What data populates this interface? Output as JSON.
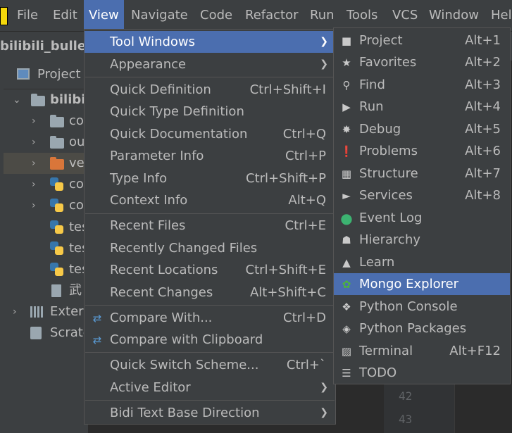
{
  "menubar": {
    "items": [
      "File",
      "Edit",
      "View",
      "Navigate",
      "Code",
      "Refactor",
      "Run",
      "Tools",
      "VCS",
      "Window",
      "Help"
    ],
    "active": "View"
  },
  "project_title": "bilibili_bullet_s",
  "project_panel": {
    "header": "Project",
    "tree": [
      {
        "label": "bilibili",
        "kind": "root-folder"
      },
      {
        "label": "co",
        "kind": "folder"
      },
      {
        "label": "ou",
        "kind": "folder"
      },
      {
        "label": "ve",
        "kind": "excluded-folder"
      },
      {
        "label": "co",
        "kind": "python-file"
      },
      {
        "label": "co",
        "kind": "python-file"
      },
      {
        "label": "tes",
        "kind": "python-file"
      },
      {
        "label": "tes",
        "kind": "python-file"
      },
      {
        "label": "tes",
        "kind": "python-file"
      },
      {
        "label": "武",
        "kind": "text-file"
      },
      {
        "label": "Extern",
        "kind": "libraries"
      },
      {
        "label": "Scrato",
        "kind": "scratches"
      }
    ]
  },
  "editor": {
    "line_numbers": [
      "42",
      "43"
    ]
  },
  "view_menu": {
    "items": [
      {
        "label": "Tool Windows",
        "shortcut": "",
        "submenu": true,
        "highlighted": true
      },
      {
        "label": "Appearance",
        "shortcut": "",
        "submenu": true
      },
      {
        "label": "Quick Definition",
        "shortcut": "Ctrl+Shift+I"
      },
      {
        "label": "Quick Type Definition",
        "shortcut": ""
      },
      {
        "label": "Quick Documentation",
        "shortcut": "Ctrl+Q"
      },
      {
        "label": "Parameter Info",
        "shortcut": "Ctrl+P"
      },
      {
        "label": "Type Info",
        "shortcut": "Ctrl+Shift+P"
      },
      {
        "label": "Context Info",
        "shortcut": "Alt+Q"
      },
      {
        "label": "Recent Files",
        "shortcut": "Ctrl+E"
      },
      {
        "label": "Recently Changed Files",
        "shortcut": ""
      },
      {
        "label": "Recent Locations",
        "shortcut": "Ctrl+Shift+E"
      },
      {
        "label": "Recent Changes",
        "shortcut": "Alt+Shift+C"
      },
      {
        "label": "Compare With...",
        "shortcut": "Ctrl+D",
        "icon": "compare-icon"
      },
      {
        "label": "Compare with Clipboard",
        "shortcut": "",
        "icon": "compare-clipboard-icon"
      },
      {
        "label": "Quick Switch Scheme...",
        "shortcut": "Ctrl+`"
      },
      {
        "label": "Active Editor",
        "shortcut": "",
        "submenu": true
      },
      {
        "label": "Bidi Text Base Direction",
        "shortcut": "",
        "submenu": true
      }
    ]
  },
  "tool_windows_menu": {
    "items": [
      {
        "label": "Project",
        "shortcut": "Alt+1",
        "icon": "folder-icon"
      },
      {
        "label": "Favorites",
        "shortcut": "Alt+2",
        "icon": "star-icon"
      },
      {
        "label": "Find",
        "shortcut": "Alt+3",
        "icon": "search-icon"
      },
      {
        "label": "Run",
        "shortcut": "Alt+4",
        "icon": "play-icon"
      },
      {
        "label": "Debug",
        "shortcut": "Alt+5",
        "icon": "bug-icon"
      },
      {
        "label": "Problems",
        "shortcut": "Alt+6",
        "icon": "problem-icon"
      },
      {
        "label": "Structure",
        "shortcut": "Alt+7",
        "icon": "structure-icon"
      },
      {
        "label": "Services",
        "shortcut": "Alt+8",
        "icon": "services-icon"
      },
      {
        "label": "Event Log",
        "shortcut": "",
        "icon": "event-log-icon"
      },
      {
        "label": "Hierarchy",
        "shortcut": "",
        "icon": "hierarchy-icon"
      },
      {
        "label": "Learn",
        "shortcut": "",
        "icon": "learn-icon"
      },
      {
        "label": "Mongo Explorer",
        "shortcut": "",
        "icon": "mongo-leaf-icon",
        "highlighted": true
      },
      {
        "label": "Python Console",
        "shortcut": "",
        "icon": "python-icon"
      },
      {
        "label": "Python Packages",
        "shortcut": "",
        "icon": "packages-icon"
      },
      {
        "label": "Terminal",
        "shortcut": "Alt+F12",
        "icon": "terminal-icon"
      },
      {
        "label": "TODO",
        "shortcut": "",
        "icon": "todo-icon"
      }
    ]
  },
  "colors": {
    "highlight": "#4b6eaf",
    "menu_bg": "#3c3f41",
    "editor_bg": "#2b2b2b",
    "mongo_leaf": "#4db33d",
    "event_log": "#3cb371"
  }
}
